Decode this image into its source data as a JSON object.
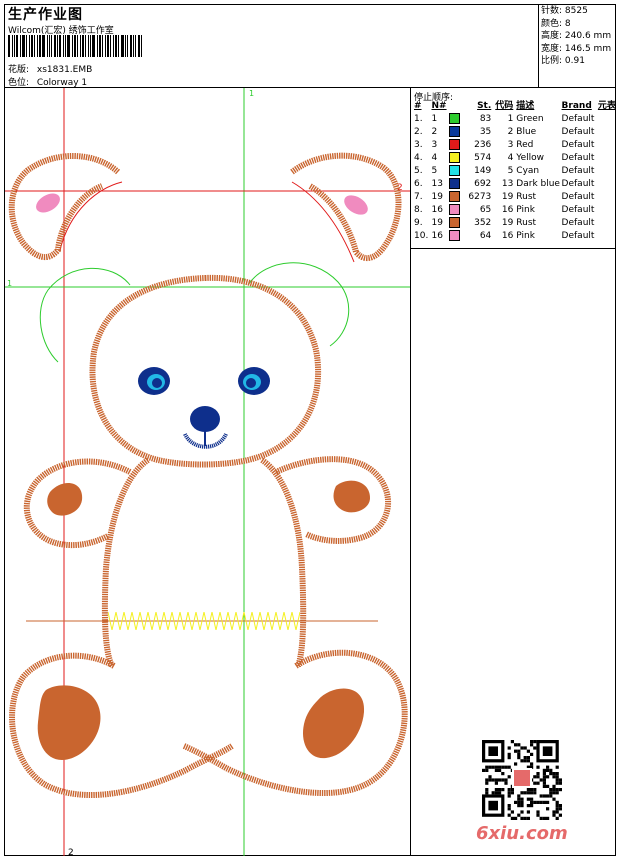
{
  "header": {
    "title": "生产作业图",
    "company": "Wilcom(汇宏) 绣饰工作室",
    "design_label": "花版:",
    "design_value": "xs1831.EMB",
    "colorway_label": "色位:",
    "colorway_value": "Colorway 1"
  },
  "stats": [
    {
      "label": "针数",
      "value": "8525"
    },
    {
      "label": "颜色",
      "value": "8"
    },
    {
      "label": "高度",
      "value": "240.6 mm"
    },
    {
      "label": "宽度",
      "value": "146.5 mm"
    },
    {
      "label": "比例",
      "value": "0.91"
    }
  ],
  "stop_sequence": {
    "heading": "停止顺序:",
    "columns": {
      "idx": "#",
      "n": "N#",
      "st": "St.",
      "code": "代码",
      "desc": "描述",
      "brand": "Brand",
      "extra": "元表"
    },
    "rows": [
      {
        "idx": "1.",
        "n": "1",
        "color": "#2ecc2e",
        "st": "83",
        "code": "1",
        "desc": "Green",
        "brand": "Default"
      },
      {
        "idx": "2.",
        "n": "2",
        "color": "#0a3a9a",
        "st": "35",
        "code": "2",
        "desc": "Blue",
        "brand": "Default"
      },
      {
        "idx": "3.",
        "n": "3",
        "color": "#e11a1a",
        "st": "236",
        "code": "3",
        "desc": "Red",
        "brand": "Default"
      },
      {
        "idx": "4.",
        "n": "4",
        "color": "#f4f020",
        "st": "574",
        "code": "4",
        "desc": "Yellow",
        "brand": "Default"
      },
      {
        "idx": "5.",
        "n": "5",
        "color": "#22e0e6",
        "st": "149",
        "code": "5",
        "desc": "Cyan",
        "brand": "Default"
      },
      {
        "idx": "6.",
        "n": "13",
        "color": "#0e2f8c",
        "st": "692",
        "code": "13",
        "desc": "Dark blue",
        "brand": "Default"
      },
      {
        "idx": "7.",
        "n": "19",
        "color": "#c9652f",
        "st": "6273",
        "code": "19",
        "desc": "Rust",
        "brand": "Default"
      },
      {
        "idx": "8.",
        "n": "16",
        "color": "#f08bbf",
        "st": "65",
        "code": "16",
        "desc": "Pink",
        "brand": "Default"
      },
      {
        "idx": "9.",
        "n": "19",
        "color": "#c9652f",
        "st": "352",
        "code": "19",
        "desc": "Rust",
        "brand": "Default"
      },
      {
        "idx": "10.",
        "n": "16",
        "color": "#f08bbf",
        "st": "64",
        "code": "16",
        "desc": "Pink",
        "brand": "Default"
      }
    ]
  },
  "guides": {
    "v1": "1",
    "v2": "2",
    "h1": "1",
    "h2": "2"
  },
  "watermark": "6xiu.com",
  "colors": {
    "rust": "#c9652f",
    "pink": "#f08bbf",
    "blue": "#0e2f8c",
    "cyan": "#22b8e6",
    "green": "#2ecc2e",
    "red": "#e11a1a",
    "yellow": "#f4f020"
  }
}
